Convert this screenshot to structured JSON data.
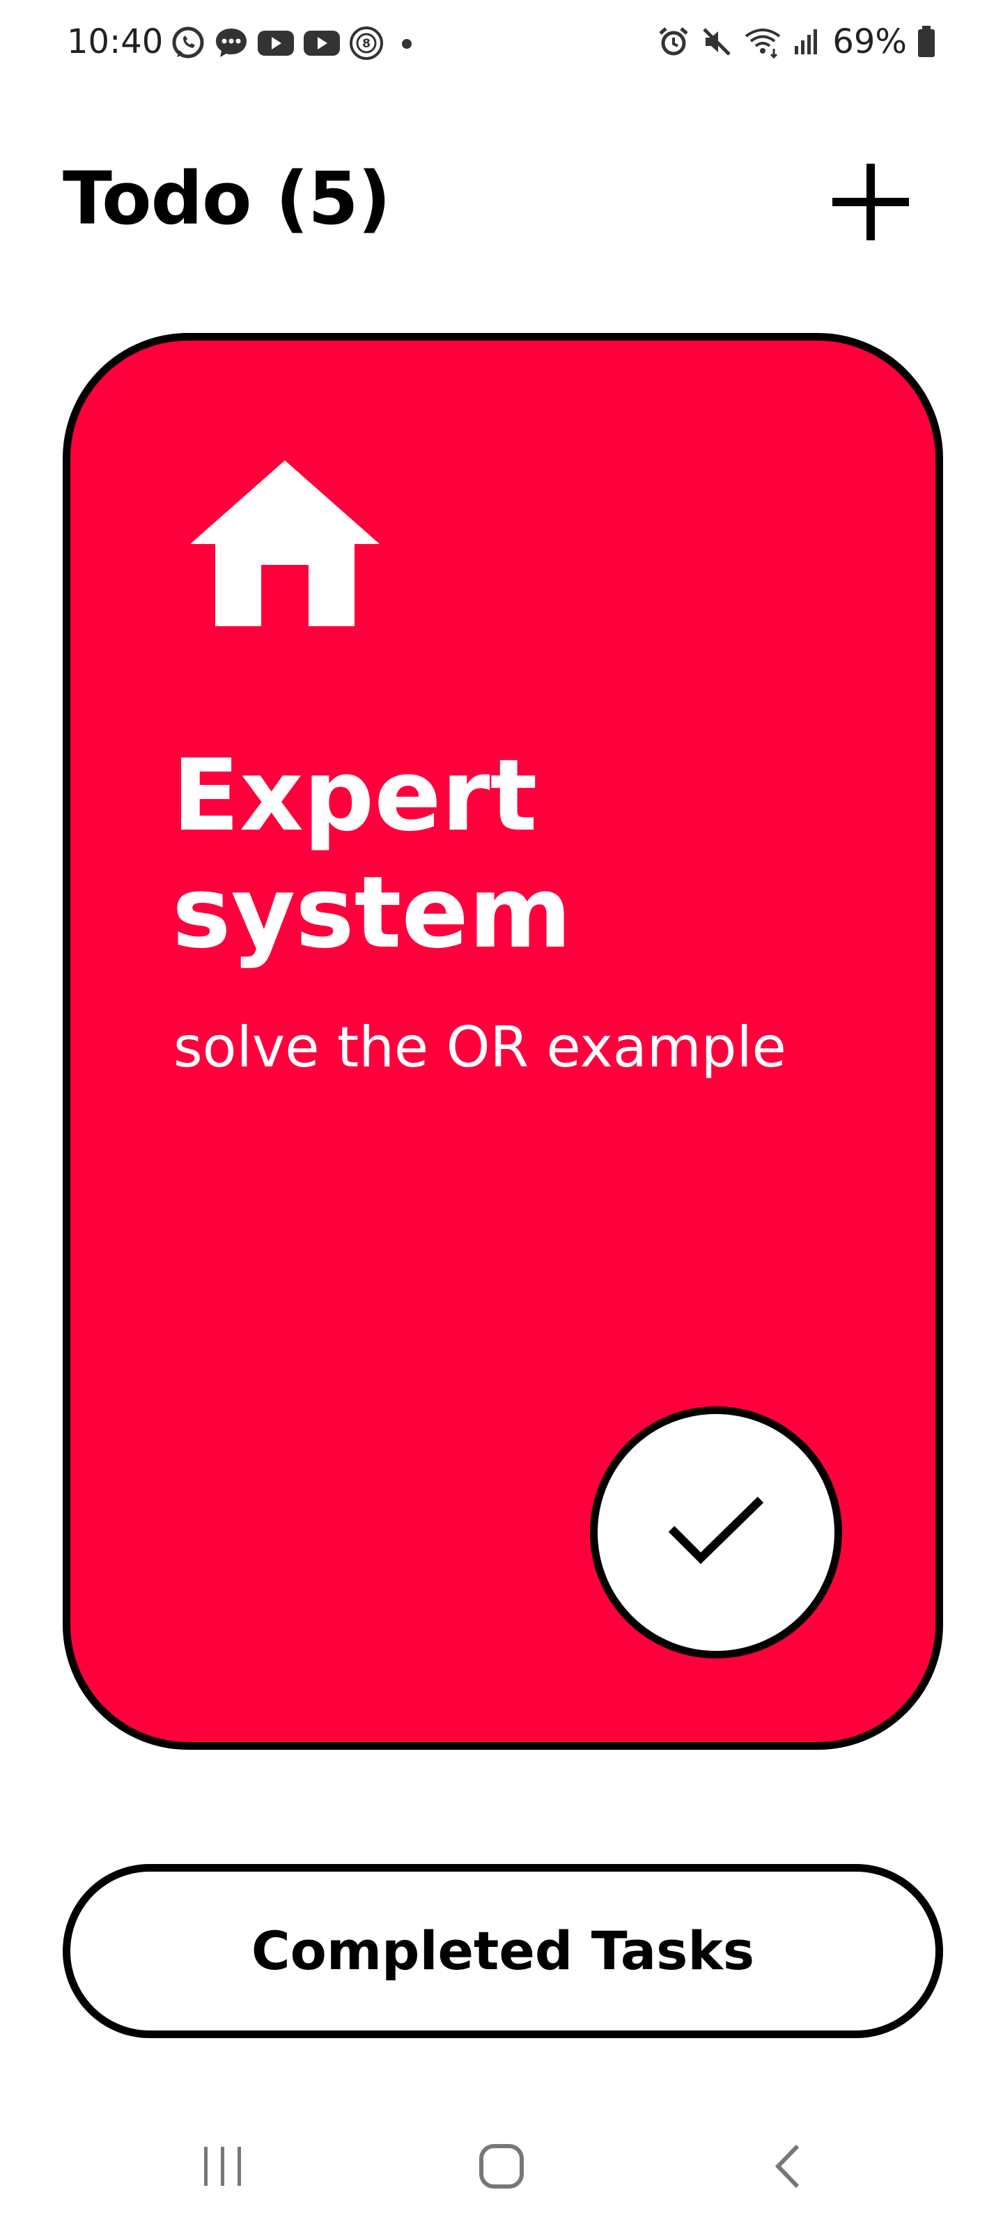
{
  "status_bar": {
    "time": "10:40",
    "battery": "69%",
    "left_icons": [
      "whatsapp-icon",
      "message-icon",
      "youtube-icon",
      "youtube-icon",
      "app-8-icon",
      "notification-dot-icon"
    ],
    "right_icons": [
      "alarm-icon",
      "mute-icon",
      "wifi-icon",
      "signal-icon",
      "battery-icon"
    ]
  },
  "header": {
    "title": "Todo (5)",
    "add_icon": "plus-icon"
  },
  "task_card": {
    "category_icon": "home-icon",
    "title": "Expert system",
    "description": "solve the OR example",
    "complete_icon": "checkmark-icon",
    "background_color": "#ff003c"
  },
  "completed_tasks_button": {
    "label": "Completed Tasks"
  },
  "nav_bar": {
    "icons": [
      "recent-apps-icon",
      "home-nav-icon",
      "back-icon"
    ]
  }
}
